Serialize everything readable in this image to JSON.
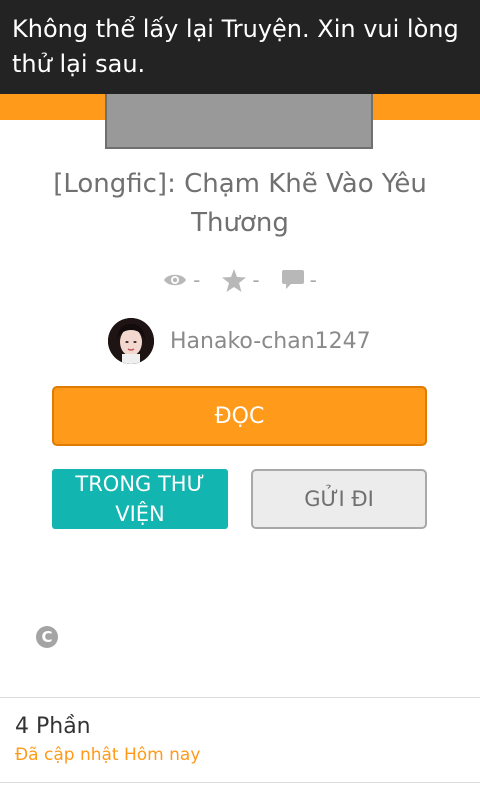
{
  "toast": {
    "message": "Không thể lấy lại Truyện. Xin vui lòng thử lại sau."
  },
  "story": {
    "title": "[Longfic]: Chạm Khẽ Vào Yêu Thương",
    "stats": {
      "views": "-",
      "votes": "-",
      "comments": "-"
    },
    "author": "Hanako-chan1247"
  },
  "actions": {
    "read_label": "ĐỌC",
    "library_label": "TRONG THƯ VIỆN",
    "send_label": "GỬI ĐI"
  },
  "icons": {
    "views": "eye-icon",
    "votes": "star-icon",
    "comments": "comment-icon",
    "license": "copyright-icon"
  },
  "license": {
    "symbol": "C"
  },
  "parts": {
    "count_label": "4 Phần",
    "updated_label": "Đã cập nhật Hôm nay"
  },
  "colors": {
    "accent": "#ff9a1a",
    "teal": "#12b5b0",
    "toast_bg": "#232323"
  }
}
